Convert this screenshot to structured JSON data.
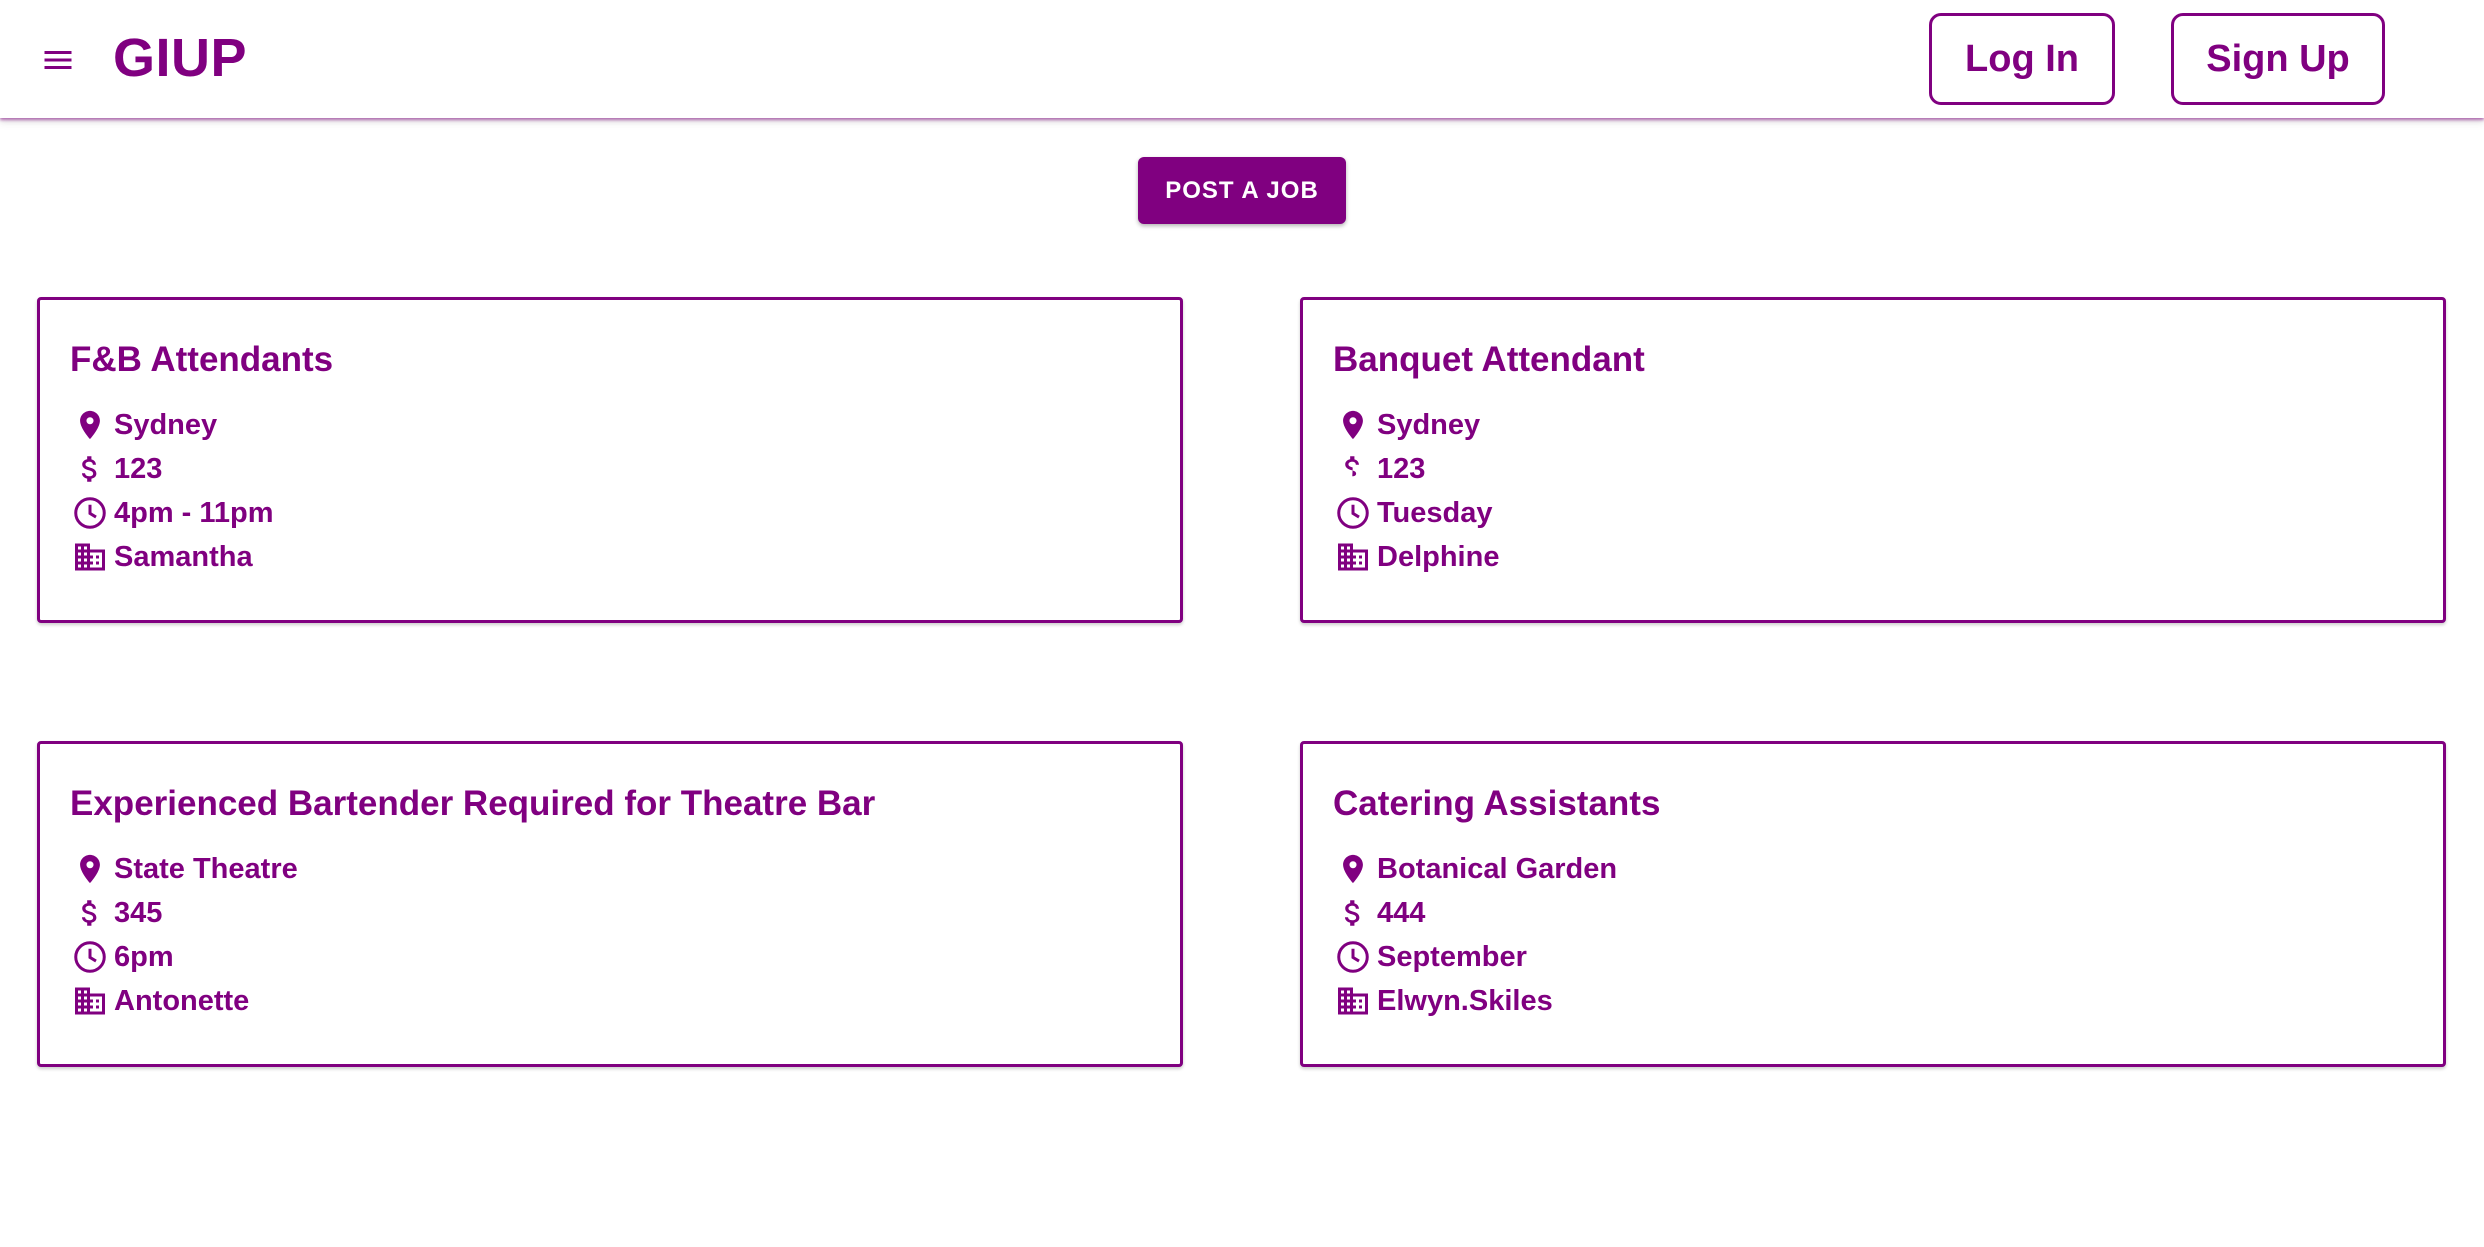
{
  "app": {
    "brand": "GIUP",
    "accent_color": "#800080"
  },
  "header": {
    "menu_icon": "hamburger-menu-icon",
    "login_label": "Log In",
    "signup_label": "Sign Up"
  },
  "actions": {
    "post_job_label": "POST A JOB"
  },
  "icons": {
    "location": "location-pin-icon",
    "pay": "dollar-icon",
    "time": "clock-icon",
    "company": "building-icon"
  },
  "jobs": [
    {
      "title": "F&B Attendants",
      "location": "Sydney",
      "pay": "123",
      "time": "4pm - 11pm",
      "company": "Samantha"
    },
    {
      "title": "Banquet Attendant",
      "location": "Sydney",
      "pay": "123",
      "time": "Tuesday",
      "company": "Delphine"
    },
    {
      "title": "Experienced Bartender Required for Theatre Bar",
      "location": "State Theatre",
      "pay": "345",
      "time": "6pm",
      "company": "Antonette"
    },
    {
      "title": "Catering Assistants",
      "location": "Botanical Garden",
      "pay": "444",
      "time": "September",
      "company": "Elwyn.Skiles"
    }
  ]
}
